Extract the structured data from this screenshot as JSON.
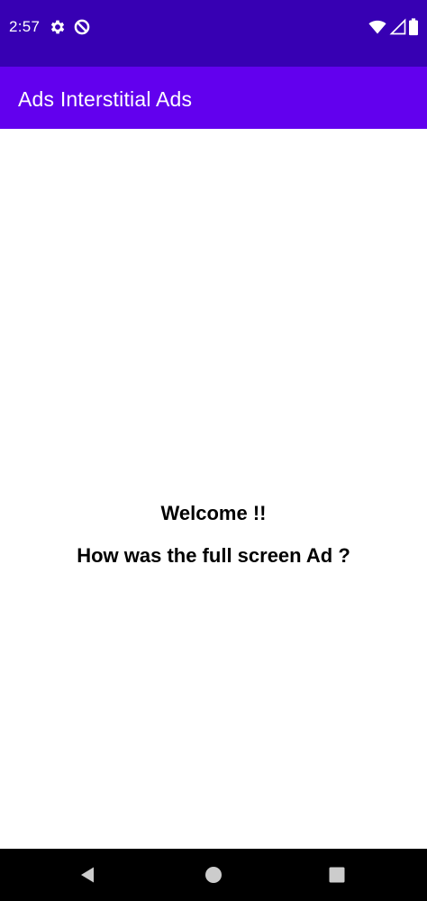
{
  "status_bar": {
    "time": "2:57",
    "icons": [
      "gear-icon",
      "do-not-disturb-icon",
      "wifi-icon",
      "signal-icon",
      "battery-icon"
    ]
  },
  "app_bar": {
    "title": "Ads Interstitial Ads"
  },
  "content": {
    "welcome_text": "Welcome !!",
    "question_text": "How was the full screen Ad ?"
  },
  "nav_bar": {
    "buttons": [
      "back-icon",
      "home-icon",
      "recents-icon"
    ]
  },
  "colors": {
    "status_bar": "#3700b3",
    "app_bar": "#6200ee",
    "background": "#ffffff",
    "nav_bar": "#000000",
    "text": "#000000",
    "icon": "#ffffff",
    "nav_icon": "#cccccc"
  }
}
